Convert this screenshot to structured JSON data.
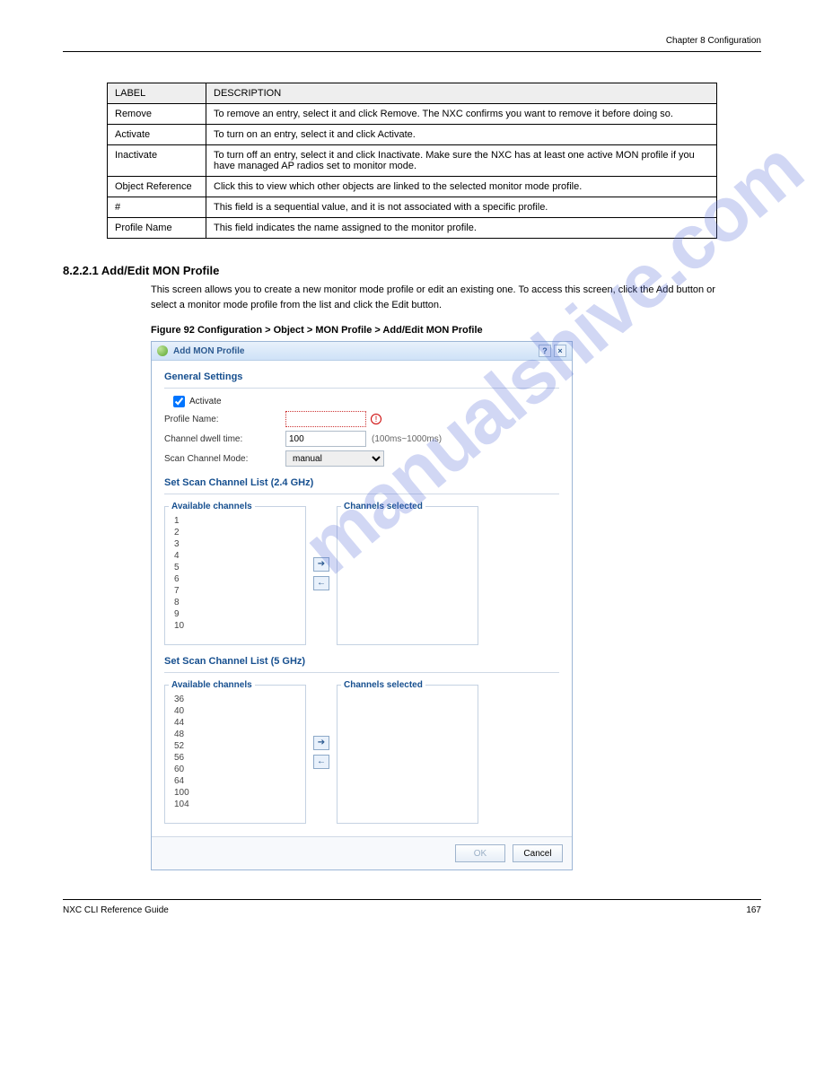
{
  "header": {
    "chapter": "Chapter 8 Configuration"
  },
  "table": {
    "h_label": "LABEL",
    "h_desc": "DESCRIPTION",
    "rows": [
      {
        "label": "Remove",
        "desc": "To remove an entry, select it and click Remove. The NXC confirms you want to remove it before doing so."
      },
      {
        "label": "Activate",
        "desc": "To turn on an entry, select it and click Activate."
      },
      {
        "label": "Inactivate",
        "desc": "To turn off an entry, select it and click Inactivate. Make sure the NXC has at least one active MON profile if you have managed AP radios set to monitor mode."
      },
      {
        "label": "Object Reference",
        "desc": "Click this to view which other objects are linked to the selected monitor mode profile."
      },
      {
        "label": "#",
        "desc": "This field is a sequential value, and it is not associated with a specific profile."
      },
      {
        "label": "Profile Name",
        "desc": "This field indicates the name assigned to the monitor profile."
      }
    ]
  },
  "section_number": "8.2.2.1  Add/Edit MON Profile",
  "section_text": "This screen allows you to create a new monitor mode profile or edit an existing one. To access this screen, click the Add button or select a monitor mode profile from the list and click the Edit button.",
  "figure_caption": "Figure 92   Configuration > Object > MON Profile > Add/Edit MON Profile",
  "dialog": {
    "title": "Add MON Profile",
    "help": "?",
    "close": "×",
    "general_settings": "General Settings",
    "activate_label": "Activate",
    "profile_name_label": "Profile Name:",
    "dwell_label": "Channel dwell time:",
    "dwell_value": "100",
    "dwell_range": "(100ms~1000ms)",
    "mode_label": "Scan Channel Mode:",
    "mode_value": "manual",
    "warn": "!",
    "scan24_title": "Set Scan Channel List (2.4 GHz)",
    "scan5_title": "Set Scan Channel List (5 GHz)",
    "available_legend": "Available channels",
    "selected_legend": "Channels selected",
    "channels24": [
      "1",
      "2",
      "3",
      "4",
      "5",
      "6",
      "7",
      "8",
      "9",
      "10"
    ],
    "channels5": [
      "36",
      "40",
      "44",
      "48",
      "52",
      "56",
      "60",
      "64",
      "100",
      "104"
    ],
    "move_right": "➔",
    "move_left": "←",
    "ok": "OK",
    "cancel": "Cancel"
  },
  "footer": {
    "left": "NXC CLI Reference Guide",
    "right": "167"
  },
  "watermark": "manualshive.com"
}
